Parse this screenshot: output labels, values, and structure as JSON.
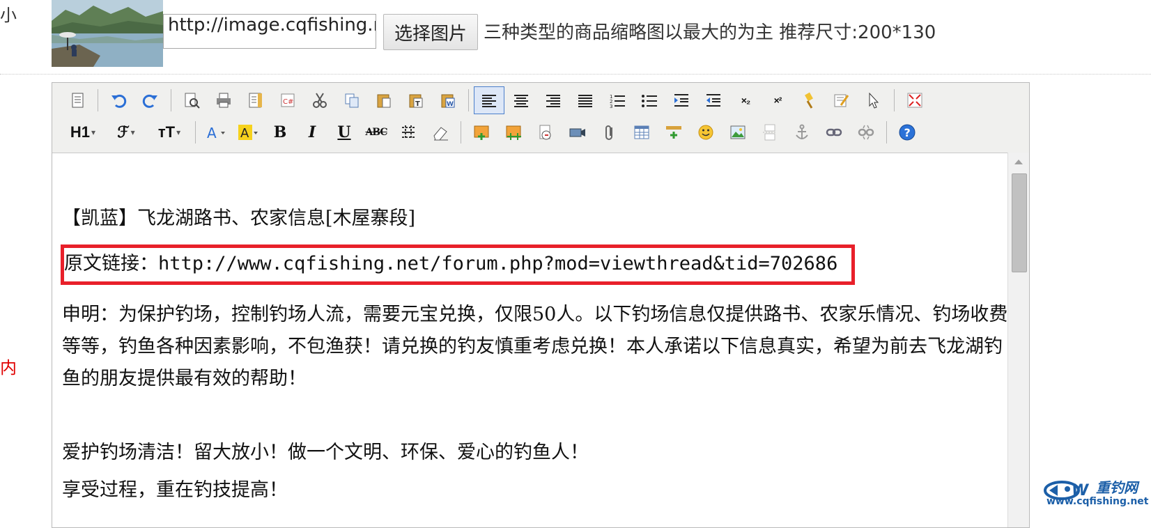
{
  "labels": {
    "small": "小",
    "inner": "内"
  },
  "thumbnail": {
    "url_value": "http://image.cqfishing.net",
    "choose_button": "选择图片",
    "hint": "三种类型的商品缩略图以最大的为主 推荐尺寸:200*130"
  },
  "toolbar": {
    "heading": "H1",
    "font_family": "ℱ",
    "font_size": "тT",
    "bold": "B",
    "italic": "I",
    "underline": "U",
    "strike": "ABC",
    "subscript": "×₂",
    "superscript": "×²",
    "caret": "▾"
  },
  "content": {
    "title": "【凯蓝】飞龙湖路书、农家信息[木屋寨段]",
    "link_label": "原文链接：",
    "link_url": "http://www.cqfishing.net/forum.php?mod=viewthread&tid=702686",
    "statement": "申明：为保护钓场，控制钓场人流，需要元宝兑换，仅限50人。以下钓场信息仅提供路书、农家乐情况、钓场收费等等，钓鱼各种因素影响，不包渔获！请兑换的钓友慎重考虑兑换！本人承诺以下信息真实，希望为前去飞龙湖钓鱼的朋友提供最有效的帮助！",
    "slogan": "爱护钓场清洁！留大放小！做一个文明、环保、爱心的钓鱼人！",
    "enjoy": "享受过程，重在钓技提高！"
  },
  "watermark": {
    "brand": "重钓网",
    "url": "www.cqfishing.net"
  },
  "colors": {
    "highlight_box": "#e8202a",
    "watermark_blue": "#1c5fa8",
    "label_red": "#e00000"
  }
}
